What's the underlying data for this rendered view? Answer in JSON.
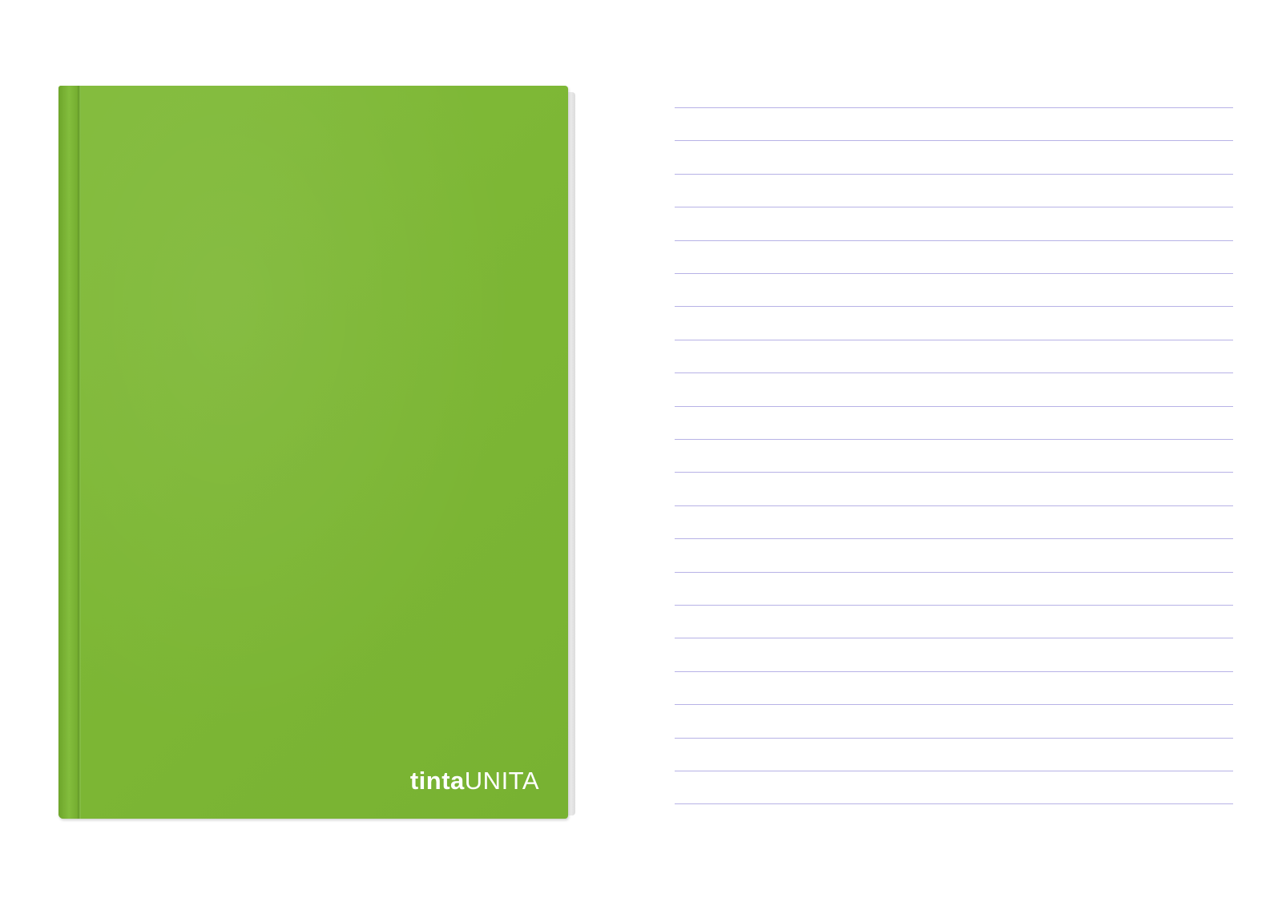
{
  "notebook": {
    "cover_color": "#7db735",
    "logo": {
      "bold_text": "tinta",
      "light_text": "UNITA"
    }
  },
  "ruled_sheet": {
    "line_color": "#b7b2e6",
    "line_count": 22
  }
}
